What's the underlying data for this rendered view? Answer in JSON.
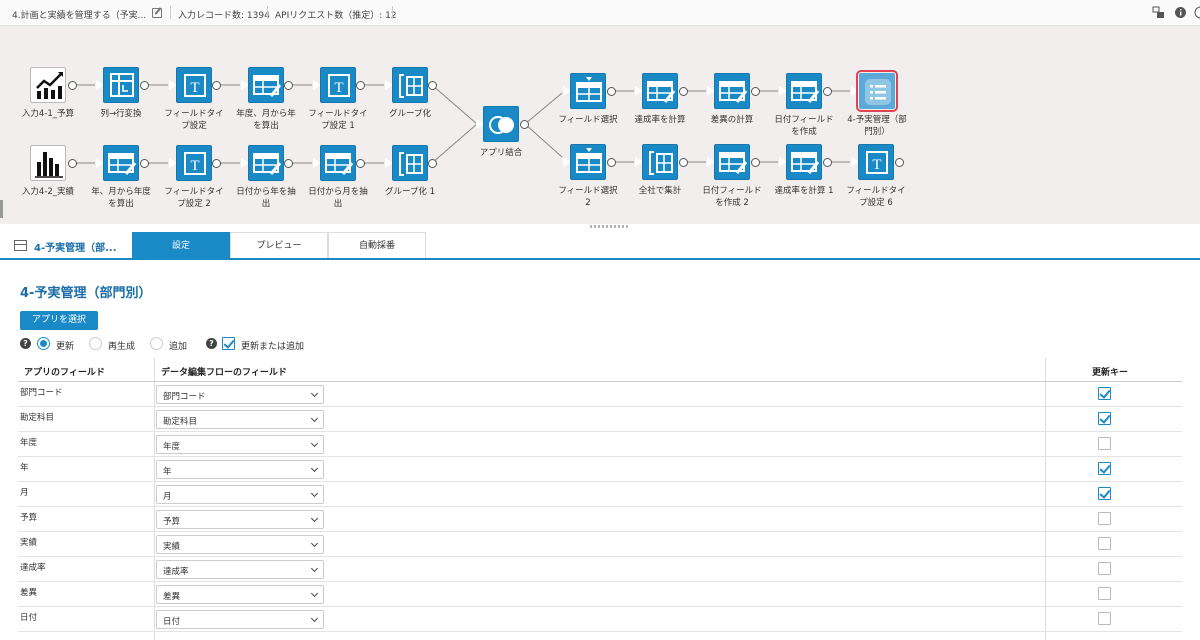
{
  "topbar": {
    "flow_title": "4.計画と実績を管理する（予実...",
    "record_count": "入力レコード数: 1394",
    "api_requests": "APIリクエスト数（推定）: 12"
  },
  "canvas": {
    "icons": {
      "input_budget": "line-chart-icon",
      "input_actual": "bar-chart-icon",
      "pivot": "table-pivot-icon",
      "field_type": "text-type-icon",
      "calc": "table-edit-icon",
      "group": "group-bracket-icon",
      "join": "join-circles-icon",
      "select": "table-select-icon",
      "output": "list-output-icon"
    },
    "nodes": {
      "n1": "入力4-1_予算",
      "n2": "列→行変換",
      "n3": "フィールドタイ\nプ設定",
      "n4": "年度、月から年\nを算出",
      "n5": "フィールドタイ\nプ設定 1",
      "n6": "グループ化",
      "m1": "入力4-2_実績",
      "m2": "年、月から年度\nを算出",
      "m3": "フィールドタイ\nプ設定 2",
      "m4": "日付から年を抽\n出",
      "m5": "日付から月を抽\n出",
      "m6": "グループ化 1",
      "join": "アプリ結合",
      "a1": "フィールド選択",
      "a2": "達成率を計算",
      "a3": "差異の計算",
      "a4": "日付フィールド\nを作成",
      "a5": "4-予実管理（部\n門別）",
      "b1": "フィールド選択\n2",
      "b2": "全社で集計",
      "b3": "日付フィールド\nを作成 2",
      "b4": "達成率を計算 1",
      "b5": "フィールドタイ\nプ設定 6"
    }
  },
  "tabs": {
    "node_title": "4-予実管理（部...",
    "settings": "設定",
    "preview": "プレビュー",
    "auto": "自動採番"
  },
  "settings": {
    "title": "4-予実管理（部門別）",
    "select_app_button": "アプリを選択",
    "mode_update": "更新",
    "mode_regenerate": "再生成",
    "mode_append": "追加",
    "mode_upsert": "更新または追加",
    "mode_selected": "更新",
    "upsert_checked": true,
    "columns": {
      "app_field": "アプリのフィールド",
      "flow_field": "データ編集フローのフィールド",
      "update_key": "更新キー"
    },
    "rows": [
      {
        "app": "部門コード",
        "flow": "部門コード",
        "key": true
      },
      {
        "app": "勘定科目",
        "flow": "勘定科目",
        "key": true
      },
      {
        "app": "年度",
        "flow": "年度",
        "key": false
      },
      {
        "app": "年",
        "flow": "年",
        "key": true
      },
      {
        "app": "月",
        "flow": "月",
        "key": true
      },
      {
        "app": "予算",
        "flow": "予算",
        "key": false
      },
      {
        "app": "実績",
        "flow": "実績",
        "key": false
      },
      {
        "app": "達成率",
        "flow": "達成率",
        "key": false
      },
      {
        "app": "差異",
        "flow": "差異",
        "key": false
      },
      {
        "app": "日付",
        "flow": "日付",
        "key": false
      }
    ]
  },
  "colors": {
    "accent": "#1a8ac7",
    "canvas_bg": "#f3eeee",
    "selected_outline": "#e04353"
  }
}
